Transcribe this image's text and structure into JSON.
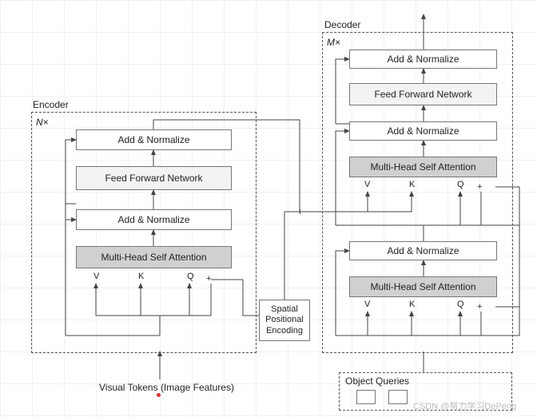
{
  "encoder": {
    "title": "Encoder",
    "repeat": "N×",
    "add_norm_top": "Add & Normalize",
    "ffn": "Feed Forward Network",
    "add_norm_mid": "Add & Normalize",
    "mha": "Multi-Head Self Attention",
    "ports": {
      "v": "V",
      "k": "K",
      "q": "Q",
      "plus": "+"
    }
  },
  "decoder": {
    "title": "Decoder",
    "repeat": "M×",
    "add_norm_top": "Add & Normalize",
    "ffn": "Feed Forward Network",
    "add_norm_mid": "Add & Normalize",
    "cross_mha": "Multi-Head Self Attention",
    "cross_ports": {
      "v": "V",
      "k": "K",
      "q": "Q",
      "plus": "+"
    },
    "add_norm_low": "Add & Normalize",
    "self_mha": "Multi-Head Self Attention",
    "self_ports": {
      "v": "V",
      "k": "K",
      "q": "Q",
      "plus": "+"
    }
  },
  "spe": "Spatial Positional Encoding",
  "visual_tokens": "Visual Tokens (Image Features)",
  "object_queries": "Object Queries",
  "center_plus": "+",
  "watermark": "CSDN @努力学习DePeng"
}
